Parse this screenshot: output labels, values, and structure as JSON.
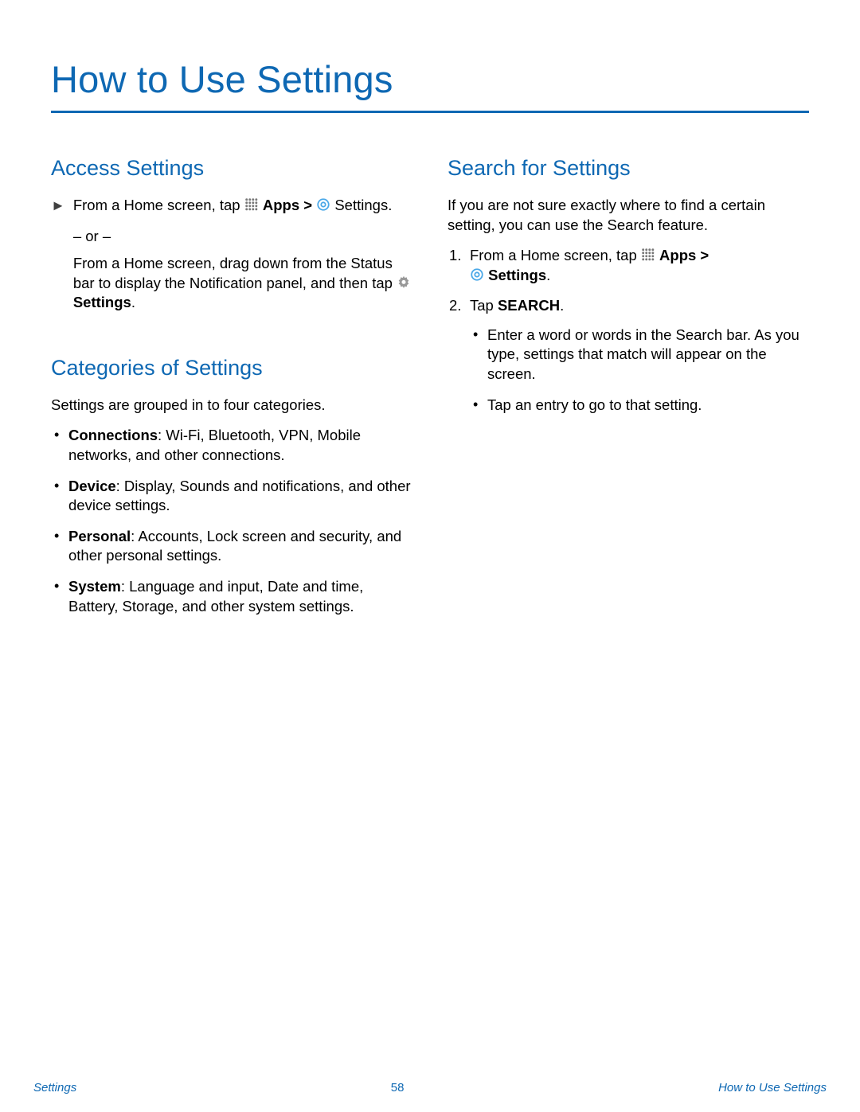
{
  "pageTitle": "How to Use Settings",
  "left": {
    "access": {
      "heading": "Access Settings",
      "line1a": "From a Home screen, tap ",
      "apps": "Apps",
      "gt": " > ",
      "settingsWord": "Settings.",
      "or": "– or –",
      "line2": "From a Home screen, drag down from the Status bar to display the Notification panel, and then tap ",
      "settingsBold": "Settings",
      "period": "."
    },
    "categories": {
      "heading": "Categories of Settings",
      "intro": "Settings are grouped in to four categories.",
      "items": [
        {
          "term": "Connections",
          "desc": ": Wi-Fi, Bluetooth, VPN, Mobile networks, and other connections."
        },
        {
          "term": "Device",
          "desc": ": Display, Sounds and notifications, and other device settings."
        },
        {
          "term": "Personal",
          "desc": ": Accounts, Lock screen and security, and other personal settings."
        },
        {
          "term": "System",
          "desc": ": Language and input, Date and time, Battery, Storage, and other system settings."
        }
      ]
    }
  },
  "right": {
    "search": {
      "heading": "Search for Settings",
      "intro": "If you are not sure exactly where to find a certain setting, you can use the Search feature.",
      "step1a": "From a Home screen, tap ",
      "apps": "Apps",
      "gt": " > ",
      "settingsBold": "Settings",
      "period": ".",
      "step2a": "Tap ",
      "searchWord": "SEARCH",
      "step2period": ".",
      "sub1": "Enter a word or words in the Search bar. As you type, settings that match will appear on the screen.",
      "sub2": "Tap an entry to go to that setting."
    }
  },
  "footer": {
    "left": "Settings",
    "center": "58",
    "right": "How to Use Settings"
  }
}
